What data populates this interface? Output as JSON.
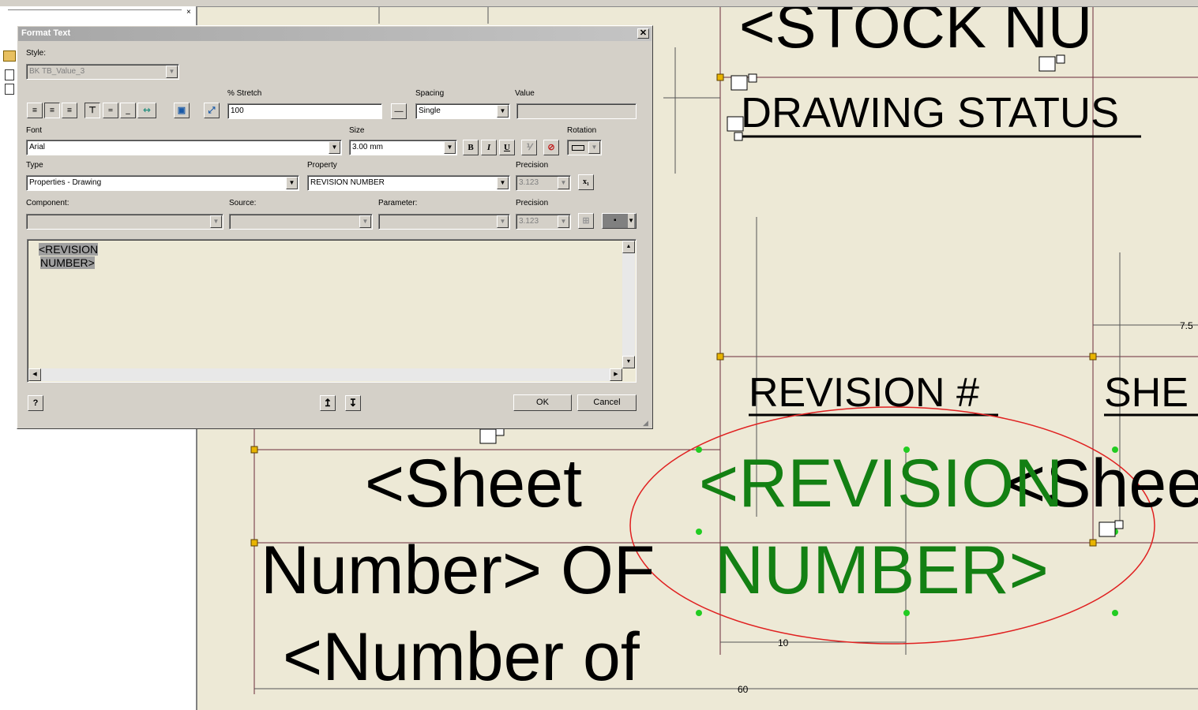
{
  "dialog": {
    "title": "Format Text",
    "close_glyph": "✕",
    "style_label": "Style:",
    "style_value": "BK TB_Value_3",
    "stretch_label": "% Stretch",
    "stretch_value": "100",
    "spacing_label": "Spacing",
    "spacing_value": "Single",
    "value_label": "Value",
    "font_label": "Font",
    "font_value": "Arial",
    "size_label": "Size",
    "size_value": "3.00 mm",
    "rotation_label": "Rotation",
    "bold_label": "B",
    "italic_label": "I",
    "underline_label": "U",
    "type_label": "Type",
    "type_value": "Properties - Drawing",
    "property_label": "Property",
    "property_value": "REVISION NUMBER",
    "precision_label": "Precision",
    "precision_value": "3.123",
    "precision2_label": "Precision",
    "precision2_value": "3.123",
    "component_label": "Component:",
    "source_label": "Source:",
    "parameter_label": "Parameter:",
    "editor_line1": "<REVISION",
    "editor_line2": "NUMBER>",
    "help_label": "?",
    "ok_label": "OK",
    "cancel_label": "Cancel"
  },
  "drawing": {
    "stock_number": "<STOCK NU",
    "drawing_status": "DRAWING STATUS",
    "revision_hash": "REVISION #",
    "sheet_header": "SHE",
    "sheet_text": "<Sheet",
    "number_of_text": "Number> OF",
    "number_of2": "<Number of",
    "revision_green": "<REVISION",
    "number_green": "NUMBER>",
    "sheet_overlap": "<Shee",
    "dim_10": "10",
    "dim_60": "60",
    "dim_75": "7.5"
  },
  "colors": {
    "annotation_red": "#e02020",
    "green_text": "#138013",
    "canvas_bg": "#ede9d6"
  }
}
